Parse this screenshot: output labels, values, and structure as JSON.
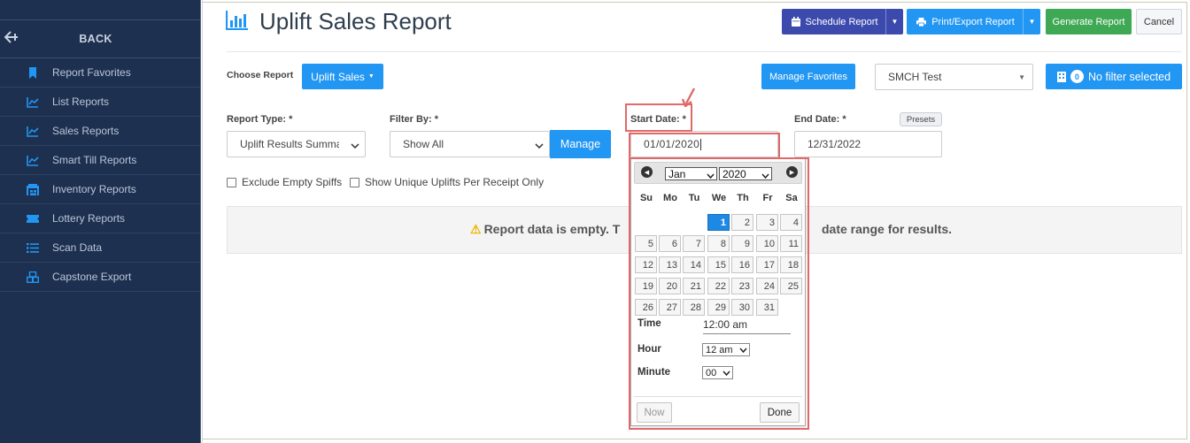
{
  "sidebar": {
    "back_label": "BACK",
    "items": [
      {
        "label": "Report Favorites",
        "icon": "bookmark-icon"
      },
      {
        "label": "List Reports",
        "icon": "line-chart-icon"
      },
      {
        "label": "Sales Reports",
        "icon": "line-chart-icon"
      },
      {
        "label": "Smart Till Reports",
        "icon": "line-chart-icon"
      },
      {
        "label": "Inventory Reports",
        "icon": "warehouse-icon"
      },
      {
        "label": "Lottery Reports",
        "icon": "ticket-icon"
      },
      {
        "label": "Scan Data",
        "icon": "list-icon"
      },
      {
        "label": "Capstone Export",
        "icon": "boxes-icon"
      }
    ]
  },
  "header": {
    "title": "Uplift Sales Report",
    "schedule_label": "Schedule Report",
    "print_label": "Print/Export Report",
    "generate_label": "Generate Report",
    "cancel_label": "Cancel"
  },
  "choose_report": {
    "label": "Choose Report",
    "value": "Uplift Sales"
  },
  "manage_favorites_label": "Manage Favorites",
  "store_select": "SMCH Test",
  "filter_badge": {
    "count": "0",
    "label": "No filter selected"
  },
  "form": {
    "report_type_label": "Report Type: *",
    "report_type_value": "Uplift Results Summary",
    "filter_by_label": "Filter By: *",
    "filter_by_value": "Show All",
    "manage_label": "Manage",
    "start_date_label": "Start Date: *",
    "start_date_value": "01/01/2020",
    "end_date_label": "End Date: *",
    "end_date_value": "12/31/2022",
    "presets_label": "Presets",
    "exclude_empty_label": "Exclude Empty Spiffs",
    "unique_uplifts_label": "Show Unique Uplifts Per Receipt Only"
  },
  "empty_message": {
    "left": "Report data is empty. T",
    "right": "date range for results."
  },
  "datepicker": {
    "month": "Jan",
    "year": "2020",
    "weekdays": [
      "Su",
      "Mo",
      "Tu",
      "We",
      "Th",
      "Fr",
      "Sa"
    ],
    "first_weekday_index": 3,
    "days_in_month": 31,
    "selected_day": 1,
    "time_label": "Time",
    "time_value": "12:00 am",
    "hour_label": "Hour",
    "hour_value": "12 am",
    "minute_label": "Minute",
    "minute_value": "00",
    "now_label": "Now",
    "done_label": "Done"
  },
  "colors": {
    "sidebar_bg": "#1e3050",
    "primary": "#2196f3",
    "indigo": "#3d4aad",
    "green": "#3ea854",
    "highlight": "#e06a6a"
  }
}
